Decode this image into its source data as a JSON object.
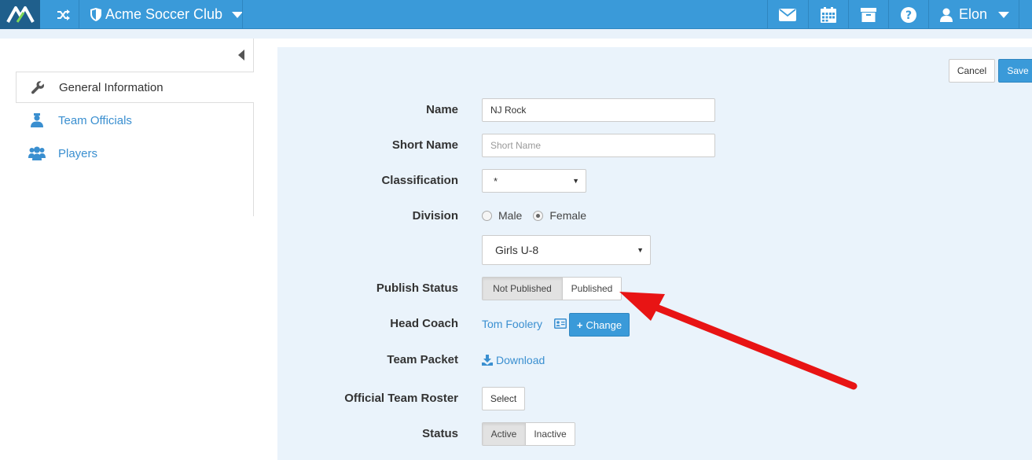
{
  "header": {
    "club_name": "Acme Soccer Club",
    "user_name": "Elon"
  },
  "sidebar": {
    "items": [
      {
        "label": "General Information",
        "icon": "wrench-icon",
        "active": true
      },
      {
        "label": "Team Officials",
        "icon": "official-icon",
        "active": false
      },
      {
        "label": "Players",
        "icon": "users-icon",
        "active": false
      }
    ]
  },
  "actions": {
    "cancel_label": "Cancel",
    "save_label": "Save"
  },
  "form": {
    "name": {
      "label": "Name",
      "value": "NJ Rock"
    },
    "short_name": {
      "label": "Short Name",
      "placeholder": "Short Name"
    },
    "classification": {
      "label": "Classification",
      "value": "*"
    },
    "division": {
      "label": "Division",
      "options": [
        "Male",
        "Female"
      ],
      "selected": "Female",
      "group_value": "Girls U-8"
    },
    "publish_status": {
      "label": "Publish Status",
      "options": [
        "Not Published",
        "Published"
      ],
      "selected": "Not Published"
    },
    "head_coach": {
      "label": "Head Coach",
      "value": "Tom Foolery",
      "change_label": "Change"
    },
    "team_packet": {
      "label": "Team Packet",
      "link_label": "Download"
    },
    "official_roster": {
      "label": "Official Team Roster",
      "button_label": "Select"
    },
    "status": {
      "label": "Status",
      "options": [
        "Active",
        "Inactive"
      ],
      "selected": "Active"
    }
  },
  "colors": {
    "primary": "#3a9ad9",
    "link": "#3a8fd0",
    "panel": "#eaf3fb",
    "annotation": "#e81414"
  }
}
